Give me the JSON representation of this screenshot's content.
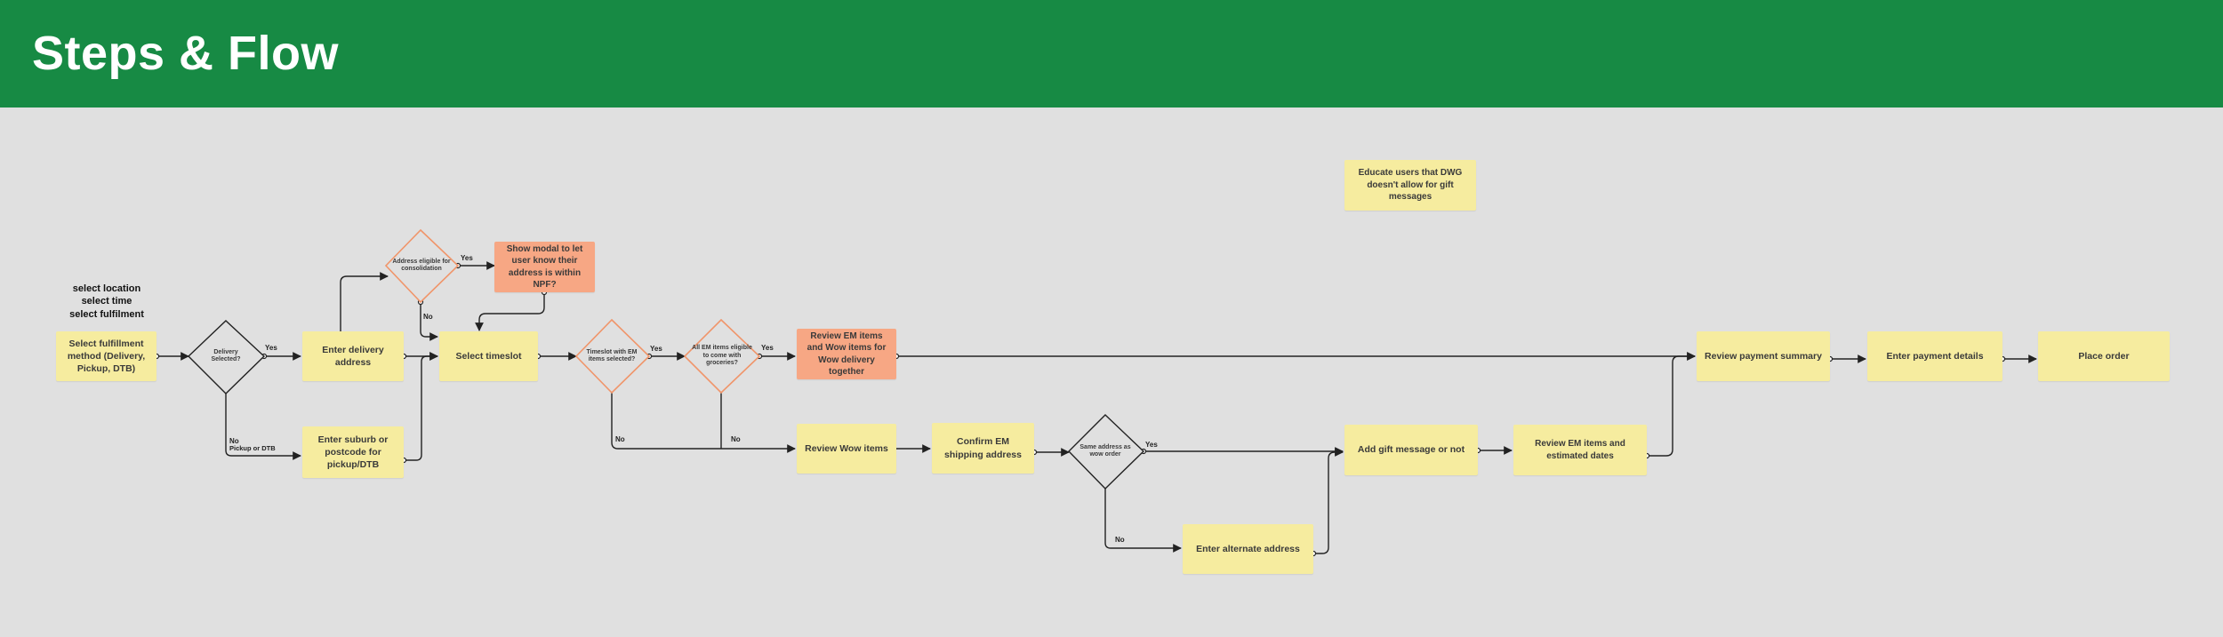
{
  "header": {
    "title": "Steps & Flow",
    "color": "#178a44"
  },
  "colors": {
    "background": "#e0e0e0",
    "sticky": "#f6ec9f",
    "sticky_highlight": "#f7a784",
    "decision_border_orange": "#f0956a",
    "decision_border_black": "#222222"
  },
  "note": {
    "lines": [
      "select location",
      "select time",
      "select fulfilment"
    ]
  },
  "nodes": {
    "select_fulfillment": "Select fulfillment method (Delivery, Pickup, DTB)",
    "delivery_selected": "Delivery Selected?",
    "enter_delivery_address": "Enter delivery address",
    "enter_suburb": "Enter suburb or postcode for pickup/DTB",
    "address_eligible": "Address eligible for consolidation",
    "show_modal": "Show modal to let user know their address is within NPF?",
    "select_timeslot": "Select timeslot",
    "timeslot_em": "Timeslot with EM items selected?",
    "all_em_items": "All EM items eligible to come with groceries?",
    "review_em_wow": "Review EM items and Wow items for Wow delivery together",
    "review_wow": "Review Wow items",
    "confirm_em_shipping": "Confirm EM shipping address",
    "same_address": "Same address as wow order",
    "enter_alternate": "Enter alternate address",
    "educate_users": "Educate users that DWG doesn't allow for gift messages",
    "add_gift_message": "Add gift message or not",
    "review_em_dates": "Review EM items and estimated dates",
    "review_payment": "Review payment summary",
    "enter_payment": "Enter payment details",
    "place_order": "Place order"
  },
  "edge_labels": {
    "delivery_yes": "Yes",
    "delivery_no": "No",
    "delivery_no_sub": "Pickup or DTB",
    "eligible_yes": "Yes",
    "eligible_no": "No",
    "timeslot_yes": "Yes",
    "timeslot_no": "No",
    "all_em_yes": "Yes",
    "all_em_no": "No",
    "same_yes": "Yes",
    "same_no": "No"
  }
}
